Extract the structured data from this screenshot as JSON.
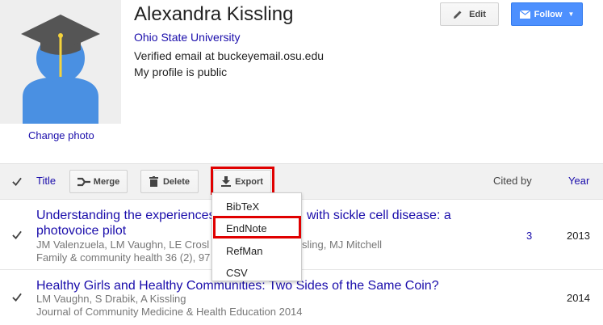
{
  "profile": {
    "name": "Alexandra Kissling",
    "affiliation": "Ohio State University",
    "email_status": "Verified email at buckeyemail.osu.edu",
    "visibility": "My profile is public",
    "change_photo": "Change photo",
    "photo_icon": "graduate-avatar-icon"
  },
  "actions": {
    "edit_label": "Edit",
    "follow_label": "Follow"
  },
  "toolbar": {
    "title_col": "Title",
    "merge_label": "Merge",
    "delete_label": "Delete",
    "export_label": "Export",
    "cited_by_col": "Cited by",
    "year_col": "Year"
  },
  "export_menu": {
    "items": [
      "BibTeX",
      "EndNote",
      "RefMan",
      "CSV"
    ],
    "highlighted": "EndNote"
  },
  "publications": [
    {
      "title_line1": "Understanding the experiences",
      "title_line1_tail": "with sickle cell disease: a",
      "title_line2": "photovoice pilot",
      "authors_head": "JM Valenzuela, LM Vaughn, LE Crosl",
      "authors_tail": "sling, MJ Mitchell",
      "source": "Family & community health 36 (2), 97",
      "cited_by": "3",
      "year": "2013",
      "checked": true
    },
    {
      "title": "Healthy Girls and Healthy Communities: Two Sides of the Same Coin?",
      "authors": "LM Vaughn, S Drabik, A Kissling",
      "source": "Journal of Community Medicine & Health Education 2014",
      "cited_by": "",
      "year": "2014",
      "checked": true
    }
  ],
  "colors": {
    "link": "#1a0dab",
    "follow_bg": "#4d90fe",
    "highlight_red": "#e00000",
    "avatar_blue": "#4a90e2",
    "cap_gray": "#555555",
    "tassel_yellow": "#f5d33c"
  }
}
